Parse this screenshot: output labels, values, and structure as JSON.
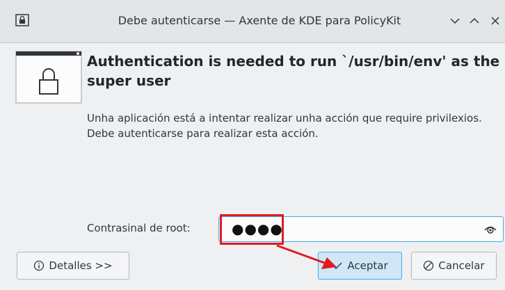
{
  "window": {
    "title": "Debe autenticarse — Axente de KDE para PolicyKit",
    "icon": "lock-window-icon",
    "controls": [
      "minimize-icon",
      "maximize-icon",
      "close-icon"
    ]
  },
  "dialog": {
    "icon": "lock-icon",
    "heading": "Authentication is needed to run `/usr/bin/env' as the super user",
    "description": "Unha aplicación está a intentar realizar unha acción que require privilexios. Debe autenticarse para realizar esta acción.",
    "password": {
      "label": "Contrasinal de root:",
      "value": "●●●●",
      "reveal_icon": "eye-icon"
    },
    "buttons": {
      "details": "Detalles >>",
      "accept": "Aceptar",
      "cancel": "Cancelar"
    }
  },
  "colors": {
    "accent": "#3daee9",
    "annotation": "#e01b24"
  }
}
